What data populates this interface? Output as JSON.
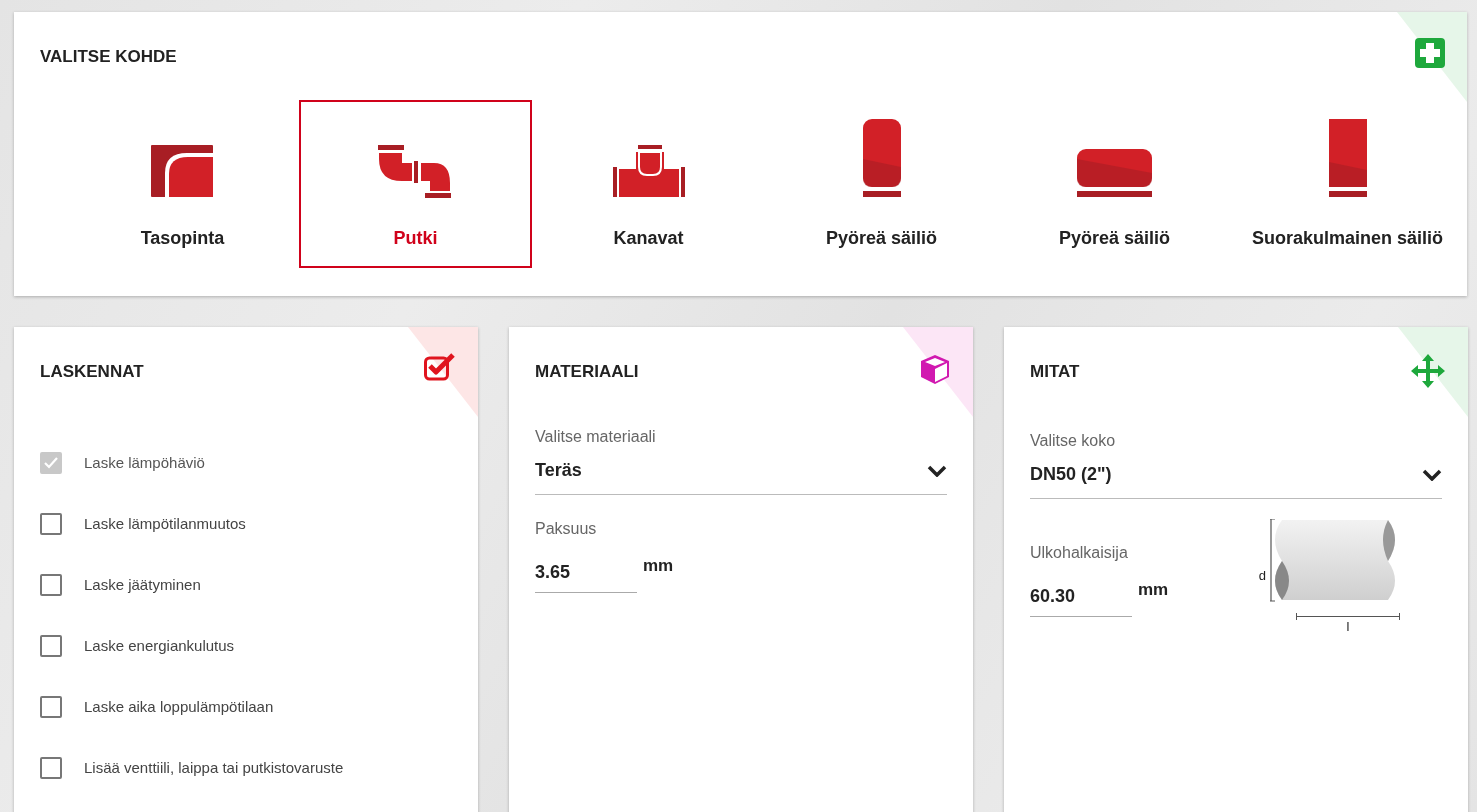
{
  "target_panel": {
    "title": "VALITSE KOHDE",
    "items": [
      {
        "label": "Tasopinta",
        "kind": "flat",
        "selected": false
      },
      {
        "label": "Putki",
        "kind": "pipe",
        "selected": true
      },
      {
        "label": "Kanavat",
        "kind": "duct",
        "selected": false
      },
      {
        "label": "Pyöreä säiliö",
        "kind": "tank-vertical",
        "selected": false
      },
      {
        "label": "Pyöreä säiliö",
        "kind": "tank-horizontal",
        "selected": false
      },
      {
        "label": "Suorakulmainen säiliö",
        "kind": "tank-rect",
        "selected": false
      }
    ]
  },
  "calculations_panel": {
    "title": "LASKENNAT",
    "options": [
      {
        "label": "Laske lämpöhäviö",
        "checked": true,
        "disabled": true
      },
      {
        "label": "Laske lämpötilanmuutos",
        "checked": false,
        "disabled": false
      },
      {
        "label": "Laske jäätyminen",
        "checked": false,
        "disabled": false
      },
      {
        "label": "Laske energiankulutus",
        "checked": false,
        "disabled": false
      },
      {
        "label": "Laske aika loppulämpötilaan",
        "checked": false,
        "disabled": false
      },
      {
        "label": "Lisää venttiili, laippa tai putkistovaruste",
        "checked": false,
        "disabled": false
      }
    ]
  },
  "material_panel": {
    "title": "MATERIAALI",
    "select": {
      "label": "Valitse materiaali",
      "value": "Teräs"
    },
    "thickness": {
      "label": "Paksuus",
      "value": "3.65",
      "unit": "mm"
    }
  },
  "dimensions_panel": {
    "title": "MITAT",
    "select": {
      "label": "Valitse koko",
      "value": "DN50 (2\")"
    },
    "outer_diameter": {
      "label": "Ulkohalkaisija",
      "value": "60.30",
      "unit": "mm"
    },
    "diagram": {
      "diameter_label": "d",
      "length_label": "l"
    }
  }
}
